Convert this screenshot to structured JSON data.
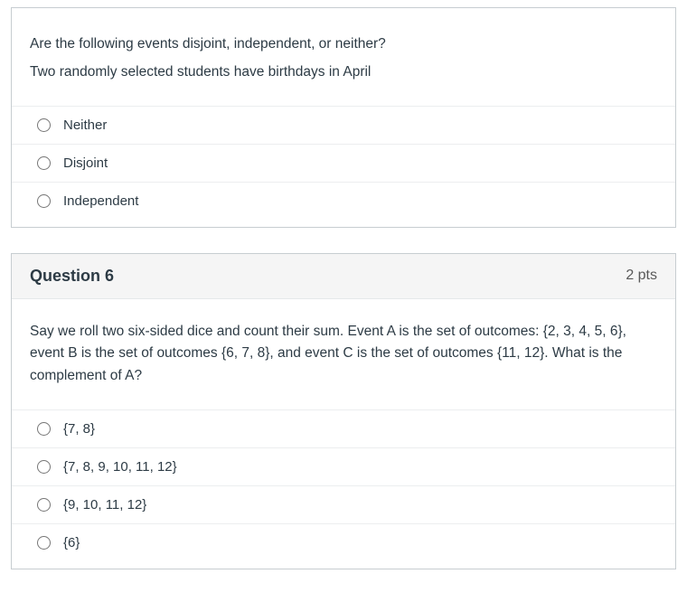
{
  "questions": [
    {
      "title": "",
      "points": "",
      "prompt_lines": [
        "Are the following events disjoint, independent, or neither?",
        "Two randomly selected students have birthdays in April"
      ],
      "options": [
        "Neither",
        "Disjoint",
        "Independent"
      ]
    },
    {
      "title": "Question 6",
      "points": "2 pts",
      "prompt_lines": [
        "Say we roll two six-sided dice and count their sum. Event A is the set of outcomes: {2, 3, 4, 5, 6}, event B is the set of outcomes {6, 7, 8}, and event C is the set of outcomes {11, 12}. What is the complement of A?"
      ],
      "options": [
        "{7, 8}",
        "{7, 8, 9, 10, 11, 12}",
        "{9, 10, 11, 12}",
        "{6}"
      ]
    }
  ]
}
